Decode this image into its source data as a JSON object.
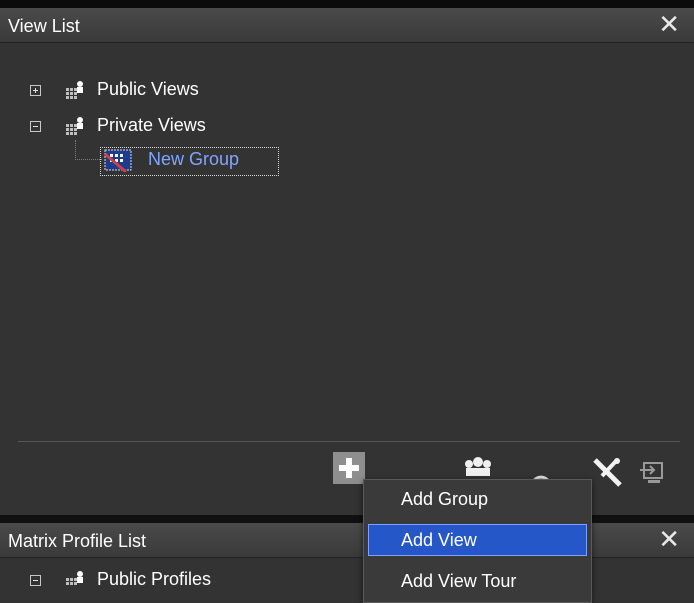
{
  "view_panel": {
    "title": "View List",
    "close_glyph": "✕",
    "tree": {
      "public_views": "Public Views",
      "private_views": "Private Views",
      "new_group": "New Group"
    }
  },
  "toolbar": {
    "icons": [
      "add-icon",
      "group-icon",
      "refresh-icon",
      "settings-icon",
      "export-icon"
    ]
  },
  "context_menu": {
    "items": [
      {
        "label": "Add Group"
      },
      {
        "label": "Add View"
      },
      {
        "label": "Add View Tour"
      }
    ],
    "active_index": 1
  },
  "matrix_panel": {
    "title": "Matrix Profile List",
    "close_glyph": "✕",
    "tree": {
      "public_profiles": "Public Profiles"
    }
  },
  "colors": {
    "panel_bg": "#333333",
    "highlight": "#2657c9",
    "new_group_text": "#7fa6ff"
  }
}
